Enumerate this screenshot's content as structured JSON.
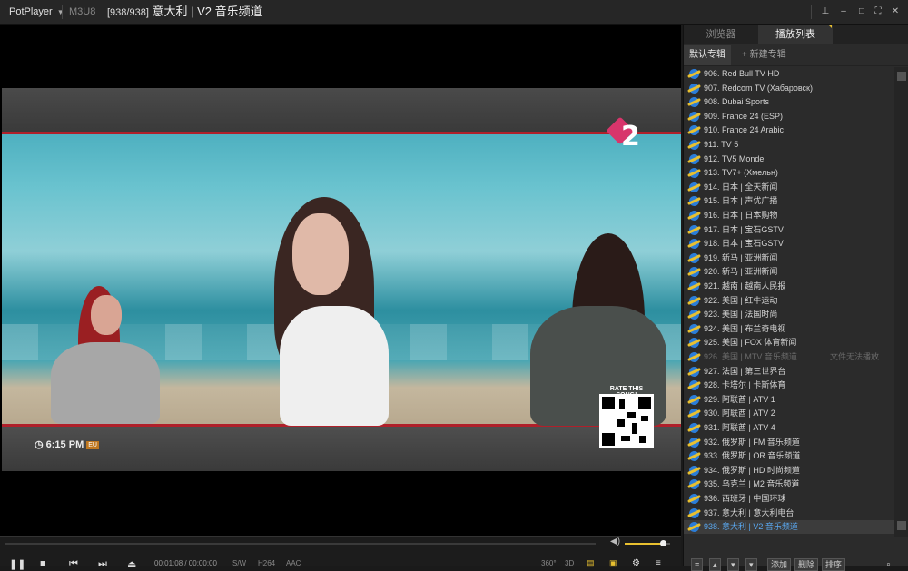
{
  "app": {
    "name": "PotPlayer",
    "format": "M3U8",
    "counter": "[938/938]",
    "title": "意大利 | V2 音乐频道"
  },
  "window_buttons": [
    "pin-icon",
    "minimize-icon",
    "maximize-icon",
    "fullscreen-icon",
    "close-icon"
  ],
  "video": {
    "clock_time": "6:15 PM",
    "clock_badge": "EU",
    "logo_text": "2",
    "qr_caption": "RATE THIS SONG!"
  },
  "controls": {
    "time": "00:01:08 / 00:00:00",
    "badges": [
      "S/W",
      "H264",
      "AAC"
    ],
    "right_badges": [
      "360°",
      "3D"
    ],
    "volume_percent": 85
  },
  "panel": {
    "tabs": [
      "浏览器",
      "播放列表"
    ],
    "active_tab": "播放列表",
    "subtabs": [
      "默认专辑",
      "+ 新建专辑"
    ],
    "buttons": [
      "添加",
      "删除",
      "排序"
    ],
    "error_text": "文件无法播放",
    "items": [
      "906. Red Bull TV HD",
      "907. Redcom TV (Хабаровск)",
      "908. Dubai Sports",
      "909. France 24 (ESP)",
      "910. France 24 Arabic",
      "911. TV 5",
      "912. TV5 Monde",
      "913. TV7+ (Хмельн)",
      "914. 日本 | 全天新闻",
      "915. 日本 | 声优广播",
      "916. 日本 | 日本购物",
      "917. 日本 | 宝石GSTV",
      "918. 日本 | 宝石GSTV",
      "919. 新马 | 亚洲新闻",
      "920. 新马 | 亚洲新闻",
      "921. 越南 | 越南人民报",
      "922. 美国 | 红牛运动",
      "923. 美国 | 法国时尚",
      "924. 美国 | 布兰奇电视",
      "925. 美国 | FOX 体育新闻",
      "926. 美国 | MTV 音乐频道",
      "927. 法国 | 第三世界台",
      "928. 卡塔尔 | 卡斯体育",
      "929. 阿联酋 | ATV 1",
      "930. 阿联酋 | ATV 2",
      "931. 阿联酋 | ATV 4",
      "932. 俄罗斯 | FM 音乐频道",
      "933. 俄罗斯 | OR 音乐频道",
      "934. 俄罗斯 | HD 时尚频道",
      "935. 乌克兰 | M2 音乐频道",
      "936. 西班牙 | 中国环球",
      "937. 意大利 | 意大利电台",
      "938. 意大利 | V2 音乐频道"
    ],
    "dim_index": 20,
    "selected_index": 32
  },
  "colors": {
    "accent": "#e8c030",
    "selected_text": "#5aa8f0",
    "red_line": "#b0202a"
  }
}
